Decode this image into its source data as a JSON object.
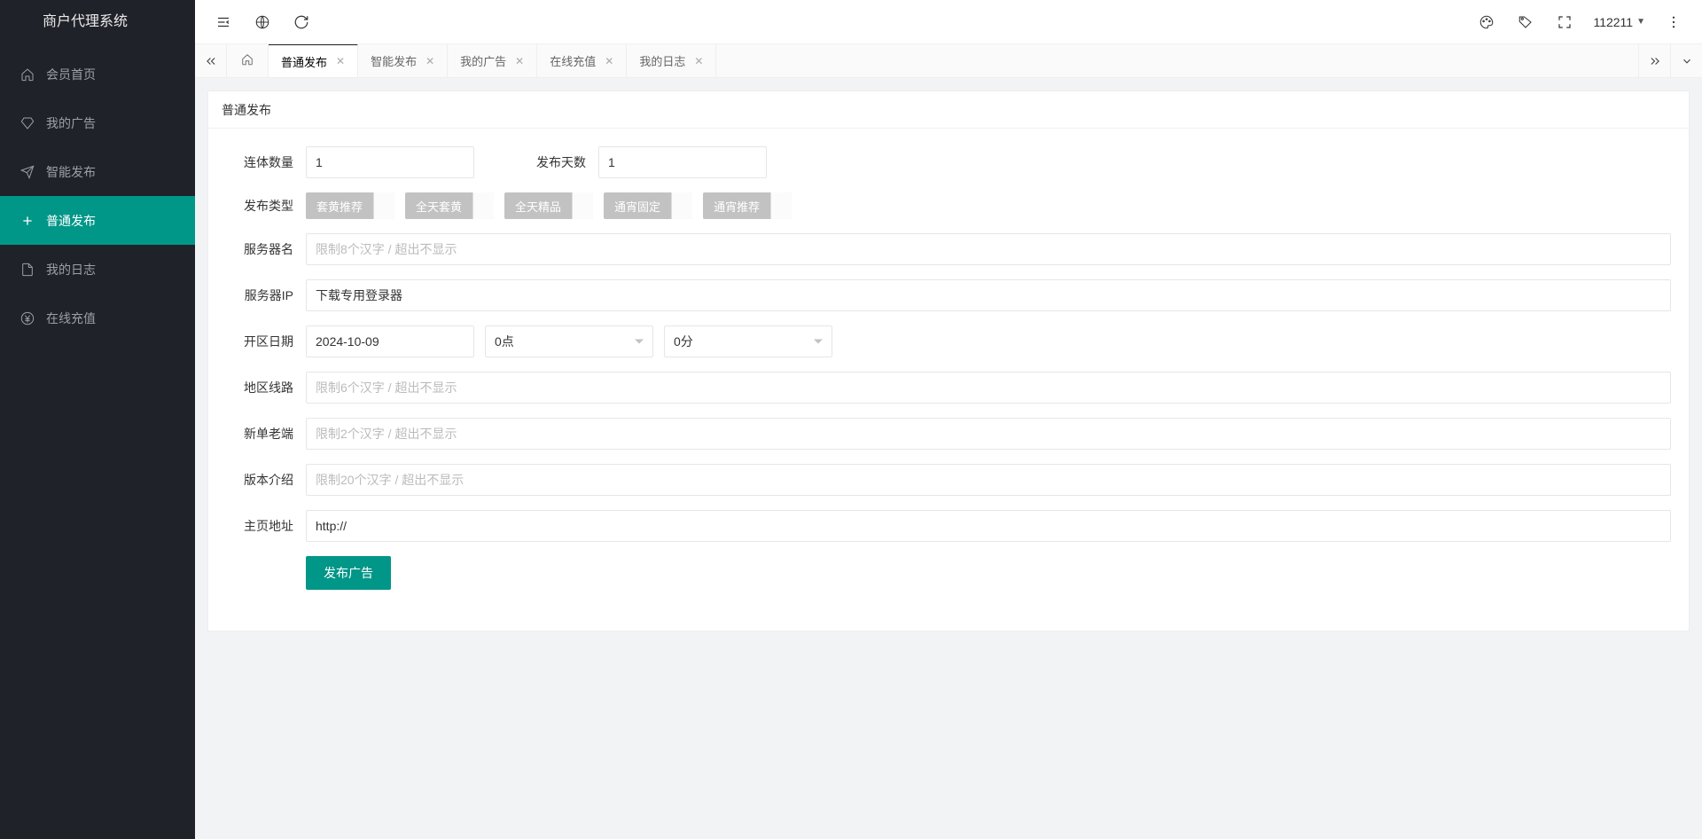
{
  "app": {
    "title": "商户代理系统"
  },
  "header": {
    "username": "112211"
  },
  "sidebar": {
    "items": [
      {
        "label": "会员首页"
      },
      {
        "label": "我的广告"
      },
      {
        "label": "智能发布"
      },
      {
        "label": "普通发布"
      },
      {
        "label": "我的日志"
      },
      {
        "label": "在线充值"
      }
    ]
  },
  "tabs": {
    "items": [
      {
        "label": "普通发布",
        "active": true
      },
      {
        "label": "智能发布"
      },
      {
        "label": "我的广告"
      },
      {
        "label": "在线充值"
      },
      {
        "label": "我的日志"
      }
    ]
  },
  "page": {
    "title": "普通发布",
    "form": {
      "lianty_qty_label": "连体数量",
      "lianty_qty_value": "1",
      "days_label": "发布天数",
      "days_value": "1",
      "pub_type_label": "发布类型",
      "type_tags": [
        {
          "label": "套黄推荐"
        },
        {
          "label": "全天套黄"
        },
        {
          "label": "全天精品"
        },
        {
          "label": "通宵固定"
        },
        {
          "label": "通宵推荐"
        }
      ],
      "server_name_label": "服务器名",
      "server_name_placeholder": "限制8个汉字 / 超出不显示",
      "server_ip_label": "服务器IP",
      "server_ip_value": "下载专用登录器",
      "open_date_label": "开区日期",
      "open_date_value": "2024-10-09",
      "hour_value": "0点",
      "minute_value": "0分",
      "region_label": "地区线路",
      "region_placeholder": "限制6个汉字 / 超出不显示",
      "newold_label": "新单老端",
      "newold_placeholder": "限制2个汉字 / 超出不显示",
      "version_label": "版本介绍",
      "version_placeholder": "限制20个汉字 / 超出不显示",
      "homepage_label": "主页地址",
      "homepage_value": "http://",
      "submit_label": "发布广告"
    }
  }
}
